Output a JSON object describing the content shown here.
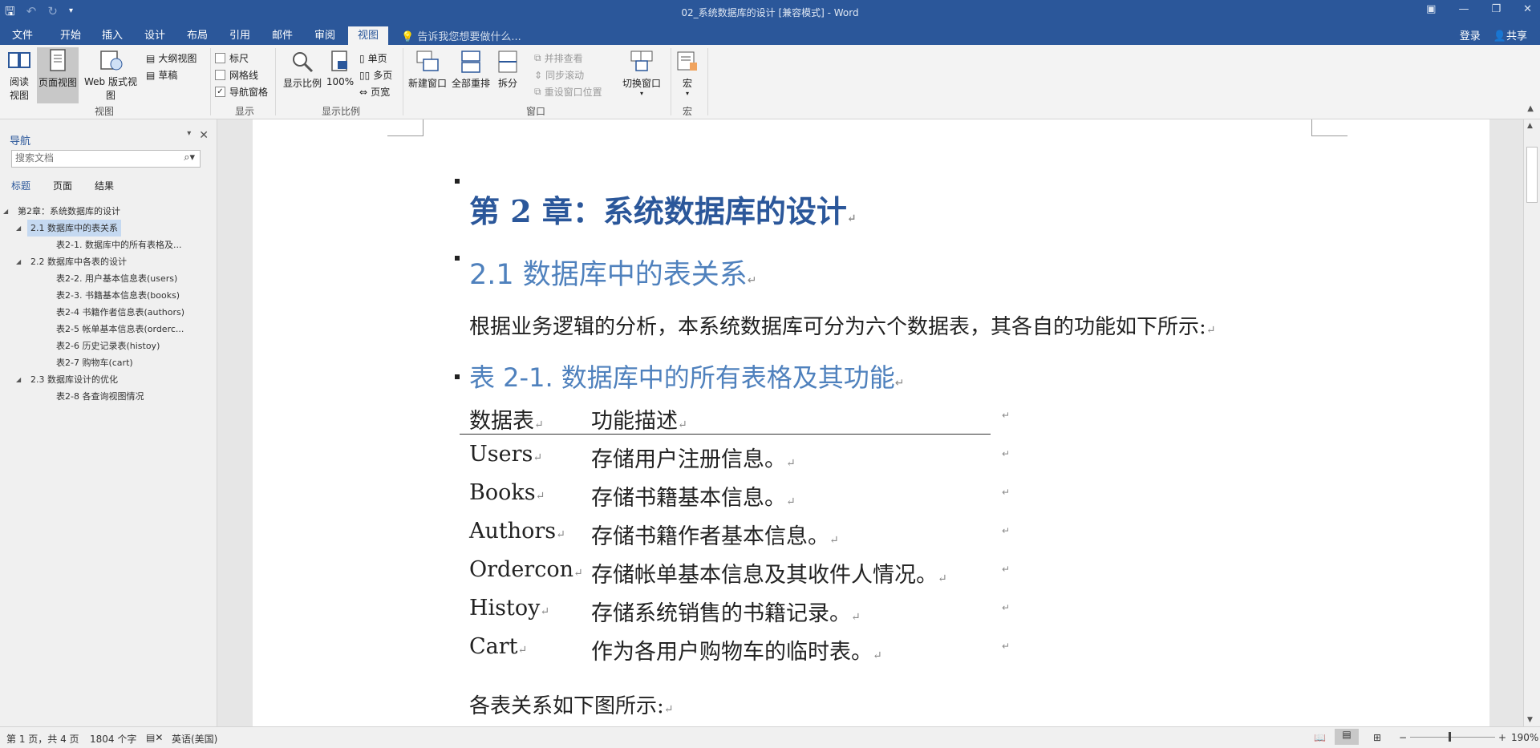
{
  "window": {
    "title": "02_系统数据库的设计 [兼容模式] - Word",
    "qat": {
      "save_icon": "save-icon",
      "undo_icon": "undo-icon",
      "redo_icon": "redo-icon",
      "customize_icon": "customize-qat-icon"
    }
  },
  "tabs": [
    "文件",
    "开始",
    "插入",
    "设计",
    "布局",
    "引用",
    "邮件",
    "审阅",
    "视图"
  ],
  "active_tab": "视图",
  "tell_me": "告诉我您想要做什么...",
  "account": {
    "login": "登录",
    "share": "共享"
  },
  "ribbon": {
    "views": {
      "read": "阅读\n视图",
      "read_l1": "阅读",
      "read_l2": "视图",
      "print": "页面视图",
      "web": "Web 版式视图",
      "outline": "大纲视图",
      "draft": "草稿",
      "label": "视图"
    },
    "show": {
      "ruler": "标尺",
      "gridlines": "网格线",
      "nav_pane": "导航窗格",
      "label": "显示",
      "nav_pane_checked": true
    },
    "zoom": {
      "zoom": "显示比例",
      "hundred": "100%",
      "one_page": "单页",
      "multi_page": "多页",
      "page_width": "页宽",
      "label": "显示比例"
    },
    "window": {
      "new_window": "新建窗口",
      "arrange_all": "全部重排",
      "split": "拆分",
      "side_by_side": "并排查看",
      "sync_scroll": "同步滚动",
      "reset_pos": "重设窗口位置",
      "switch": "切换窗口",
      "label": "窗口"
    },
    "macros": {
      "macros": "宏",
      "label": "宏"
    }
  },
  "nav": {
    "title": "导航",
    "search_placeholder": "搜索文档",
    "tabs": [
      "标题",
      "页面",
      "结果"
    ],
    "tree": [
      {
        "level": 0,
        "text": "第2章：系统数据库的设计",
        "expanded": true
      },
      {
        "level": 1,
        "text": "2.1 数据库中的表关系",
        "expanded": true,
        "selected": true
      },
      {
        "level": 2,
        "text": "表2-1. 数据库中的所有表格及..."
      },
      {
        "level": 1,
        "text": "2.2 数据库中各表的设计",
        "expanded": true
      },
      {
        "level": 2,
        "text": "表2-2. 用户基本信息表(users)"
      },
      {
        "level": 2,
        "text": "表2-3. 书籍基本信息表(books)"
      },
      {
        "level": 2,
        "text": "表2-4 书籍作者信息表(authors)"
      },
      {
        "level": 2,
        "text": "表2-5 帐单基本信息表(orderc..."
      },
      {
        "level": 2,
        "text": "表2-6 历史记录表(histoy)"
      },
      {
        "level": 2,
        "text": "表2-7 购物车(cart)"
      },
      {
        "level": 1,
        "text": "2.3 数据库设计的优化",
        "expanded": true
      },
      {
        "level": 2,
        "text": "表2-8 各查询视图情况"
      }
    ]
  },
  "document": {
    "heading1": "第 2 章：系统数据库的设计",
    "heading2": "2.1 数据库中的表关系",
    "intro": "根据业务逻辑的分析，本系统数据库可分为六个数据表，其各自的功能如下所示:",
    "caption": "表 2-1. 数据库中的所有表格及其功能",
    "table": {
      "headers": [
        "数据表",
        "功能描述"
      ],
      "rows": [
        [
          "Users",
          "存储用户注册信息。"
        ],
        [
          "Books",
          "存储书籍基本信息。"
        ],
        [
          "Authors",
          "存储书籍作者基本信息。"
        ],
        [
          "Ordercon",
          "存储帐单基本信息及其收件人情况。"
        ],
        [
          "Histoy",
          "存储系统销售的书籍记录。"
        ],
        [
          "Cart",
          "作为各用户购物车的临时表。"
        ]
      ]
    },
    "after": "各表关系如下图所示:",
    "para_mark": "↵"
  },
  "status": {
    "page": "第 1 页，共 4 页",
    "words": "1804 个字",
    "proof_icon": "proofing-icon",
    "language": "英语(美国)",
    "zoom": "190%",
    "zoom_fraction": 0.45
  },
  "colors": {
    "accent": "#2b579a",
    "heading2": "#4f81bd",
    "nav_selected": "#c5d9f1"
  }
}
